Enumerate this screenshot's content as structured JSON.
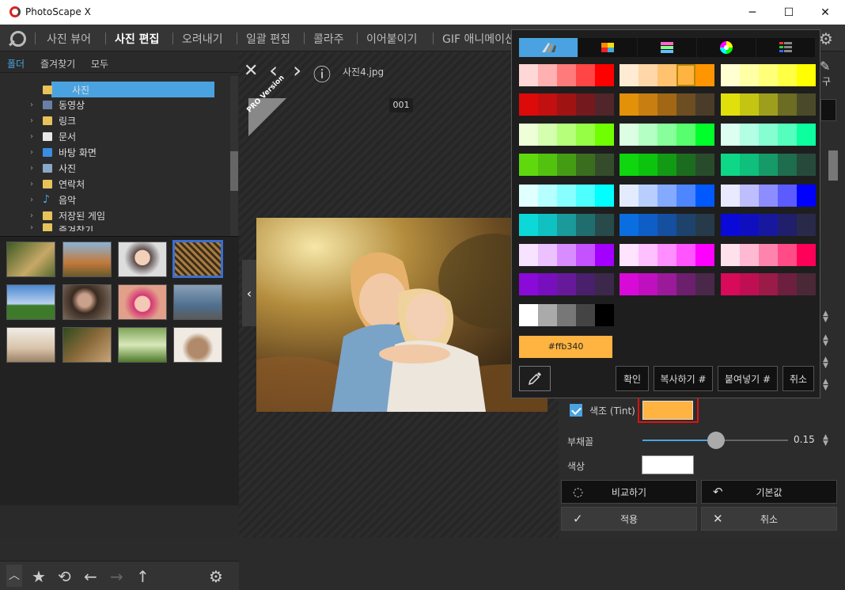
{
  "window": {
    "title": "PhotoScape X",
    "minimize": "─",
    "maximize": "☐",
    "close": "✕"
  },
  "nav": {
    "tabs": [
      "사진 뷰어",
      "사진 편집",
      "오려내기",
      "일괄 편집",
      "콜라주",
      "이어붙이기",
      "GIF 애니메이션"
    ],
    "active": "사진 편집"
  },
  "left": {
    "tabs": [
      "폴더",
      "즐겨찾기",
      "모두"
    ],
    "tree": [
      {
        "label": "사진",
        "icon": "folder-icon",
        "selected": true,
        "arrow": ""
      },
      {
        "label": "동영상",
        "icon": "video-folder-icon",
        "arrow": "›"
      },
      {
        "label": "링크",
        "icon": "folder-icon",
        "arrow": "›"
      },
      {
        "label": "문서",
        "icon": "document-icon",
        "arrow": "›"
      },
      {
        "label": "바탕 화면",
        "icon": "desktop-icon",
        "arrow": "›"
      },
      {
        "label": "사진",
        "icon": "pictures-icon",
        "arrow": "›"
      },
      {
        "label": "연락처",
        "icon": "folder-icon",
        "arrow": "›"
      },
      {
        "label": "음악",
        "icon": "music-icon",
        "arrow": "›"
      },
      {
        "label": "저장된 게임",
        "icon": "folder-icon",
        "arrow": "›"
      },
      {
        "label": "즐겨찾기",
        "icon": "folder-icon",
        "arrow": "›"
      }
    ],
    "bottom_icons": [
      "chevron-up-icon",
      "star-icon",
      "refresh-icon",
      "arrow-left-icon",
      "arrow-right-icon",
      "arrow-up-icon",
      "gear-icon"
    ]
  },
  "center": {
    "filename": "사진4.jpg",
    "counter": "001",
    "pro_label": "PRO Version",
    "toolbar": {
      "close": "✕",
      "prev": "‹",
      "next": "›",
      "info": "ⓘ"
    }
  },
  "picker": {
    "hex": "#ffb340",
    "confirm": "확인",
    "copy": "복사하기 #",
    "paste": "붙여넣기 #",
    "cancel": "취소",
    "palette": [
      [
        "#ffd7d7",
        "#ffb0b0",
        "#ff7a7a",
        "#ff4545",
        "#ff0000"
      ],
      [
        "#ffead2",
        "#ffd7a8",
        "#ffc26f",
        "#ffb340",
        "#ff9500"
      ],
      [
        "#ffffd2",
        "#ffffa6",
        "#ffff79",
        "#ffff43",
        "#ffff00"
      ],
      [
        "#dd0a0a",
        "#c20f0f",
        "#a01313",
        "#74191d",
        "#52252a"
      ],
      [
        "#e29109",
        "#c87e10",
        "#a16715",
        "#6d4d22",
        "#4a3c28"
      ],
      [
        "#e0e00c",
        "#c4c413",
        "#9e9e1d",
        "#6c6c22",
        "#4a4a2a"
      ],
      [
        "#eeffd8",
        "#d4ffae",
        "#b6ff7b",
        "#96ff45",
        "#70ff00"
      ],
      [
        "#dcffe4",
        "#b4ffc3",
        "#87ff9b",
        "#57ff6e",
        "#00ff2a"
      ],
      [
        "#dcfff1",
        "#b2ffe3",
        "#85ffd2",
        "#54ffbd",
        "#0cff9f"
      ],
      [
        "#5fd90d",
        "#53c20f",
        "#449c15",
        "#3b6d1f",
        "#354c2c"
      ],
      [
        "#0fd60f",
        "#0cc30d",
        "#129a14",
        "#1c6c1f",
        "#284c2b"
      ],
      [
        "#0ed788",
        "#0fbf7c",
        "#169a67",
        "#1d6d4e",
        "#27493c"
      ],
      [
        "#e0ffff",
        "#b6ffff",
        "#87ffff",
        "#4dffff",
        "#00ffff"
      ],
      [
        "#e3ecff",
        "#b8ceff",
        "#84aaff",
        "#4d86ff",
        "#0059ff"
      ],
      [
        "#e9e9ff",
        "#bebeff",
        "#8d8dff",
        "#5b5bff",
        "#0000ff"
      ],
      [
        "#0cd8d8",
        "#10c1c1",
        "#1a9a9a",
        "#206d6d",
        "#284a4a"
      ],
      [
        "#0a6ee0",
        "#0f5dc7",
        "#15509f",
        "#1d436c",
        "#263a4a"
      ],
      [
        "#0a0ad8",
        "#0f0fbf",
        "#18189e",
        "#1f1f6c",
        "#29294a"
      ],
      [
        "#f7e2ff",
        "#ebc1ff",
        "#d98cff",
        "#c452ff",
        "#a400ff"
      ],
      [
        "#ffe3ff",
        "#ffc0ff",
        "#ff8eff",
        "#ff55ff",
        "#ff00ff"
      ],
      [
        "#ffe1ec",
        "#ffb9d2",
        "#ff84ad",
        "#ff4c87",
        "#ff0058"
      ],
      [
        "#8a0ad8",
        "#770fbf",
        "#661a9a",
        "#4a1f6c",
        "#3c284a"
      ],
      [
        "#d80ad8",
        "#bf0fbf",
        "#9a1a9a",
        "#6c1f6c",
        "#4a284a"
      ],
      [
        "#d80a5a",
        "#bf0f52",
        "#9a1a48",
        "#6c1f3e",
        "#4a2836"
      ],
      [
        "#ffffff",
        "#aaaaaa",
        "#777777",
        "#444444",
        "#000000"
      ]
    ]
  },
  "right": {
    "tint_label": "색조 (Tint)",
    "opacity_label": "부채꼴",
    "opacity_value": "0.15",
    "opacity_fraction": 0.5,
    "color_label": "색상",
    "compare": "비교하기",
    "default": "기본값",
    "apply": "적용",
    "cancel": "취소",
    "partial_label": "구"
  }
}
